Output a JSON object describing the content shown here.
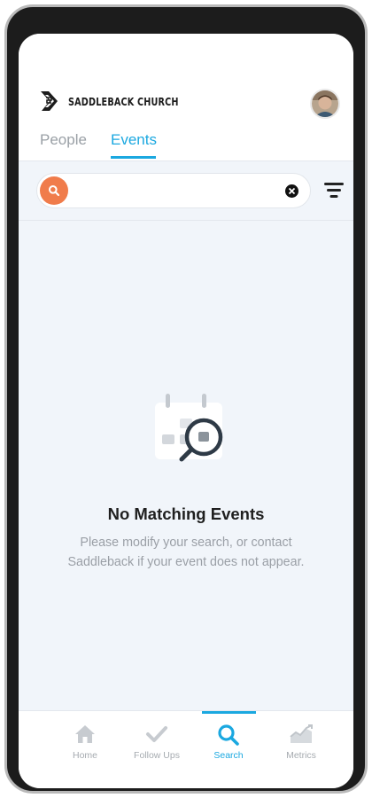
{
  "brand": {
    "name": "SADDLEBACK CHURCH"
  },
  "tabs": [
    {
      "label": "People",
      "active": false
    },
    {
      "label": "Events",
      "active": true
    }
  ],
  "search": {
    "value": "",
    "placeholder": ""
  },
  "empty_state": {
    "title": "No Matching Events",
    "message": "Please modify your search, or contact Saddleback if your event does not appear."
  },
  "bottom_nav": [
    {
      "label": "Home",
      "icon": "home-icon",
      "active": false
    },
    {
      "label": "Follow Ups",
      "icon": "check-icon",
      "active": false
    },
    {
      "label": "Search",
      "icon": "search-icon",
      "active": true
    },
    {
      "label": "Metrics",
      "icon": "chart-icon",
      "active": false
    }
  ],
  "colors": {
    "accent": "#1ba8e0",
    "search_button": "#f07c4b",
    "background": "#f1f5fa"
  }
}
